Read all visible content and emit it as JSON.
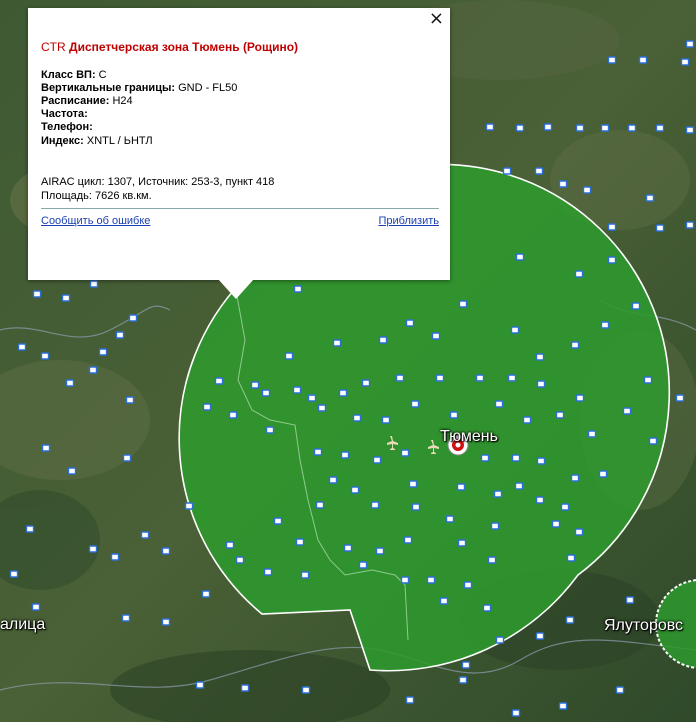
{
  "map": {
    "place_labels": [
      "Тюмень",
      "Ялуторовс",
      "алица"
    ],
    "zone_color": "#2e9a2e",
    "icons": [
      "airplane-icon",
      "aerodrome-marker-icon",
      "airfield-icon"
    ]
  },
  "popup": {
    "close_label": "×",
    "title_prefix": "CTR",
    "title_name": "Диспетчерская зона Тюмень (Рощино)",
    "rows": [
      {
        "label": "Класс ВП:",
        "value": " C"
      },
      {
        "label": "Вертикальные границы:",
        "value": " GND - FL50"
      },
      {
        "label": "Расписание:",
        "value": " H24"
      },
      {
        "label": "Частота:",
        "value": ""
      },
      {
        "label": "Телефон:",
        "value": ""
      },
      {
        "label": "Индекс:",
        "value": " XNTL / ЬНТЛ"
      }
    ],
    "airac": "AIRAC цикл: 1307, Источник: 253-3, пункт 418",
    "area": "Площадь: 7626 кв.км.",
    "report_link": "Сообщить об ошибке",
    "zoom_link": "Приблизить"
  }
}
